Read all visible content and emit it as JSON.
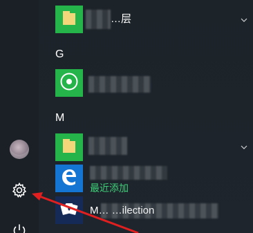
{
  "sections": {
    "g": "G",
    "m": "M"
  },
  "apps": {
    "folder1_label": "…层",
    "groove_label": "",
    "folder2_label": "",
    "edge_sub": "最近添加",
    "solitaire_label": "M… …ilection"
  },
  "icons": {
    "settings": "gear-icon",
    "power": "power-icon",
    "user": "avatar",
    "expand": "chevron-down-icon"
  },
  "colors": {
    "tile_green": "#25b44a",
    "tile_edge": "#1575d3",
    "tile_dark": "#152a57",
    "accent_green": "#3fcf79",
    "arrow_red": "#e02020"
  }
}
